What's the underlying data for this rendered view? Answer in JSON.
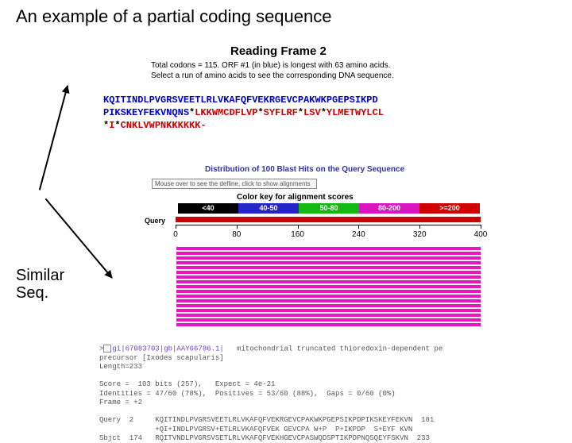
{
  "title": "An example of a partial coding sequence",
  "similar_label": "Similar\nSeq.",
  "reading_frame": {
    "heading": "Reading Frame 2",
    "sub1": "Total codons = 115.   ORF #1 (in blue) is longest with 63 amino acids.",
    "sub2": "Select a run of amino acids to see the corresponding DNA sequence.",
    "line1_orf": "KQITINDLPVGRSVEETLRLVKAFQFVEKRGEVCPAKWKPGEPSIKPD",
    "line2_orf": "PIKSKEYFEKVNQNS",
    "line2_star": "*",
    "line2_rest_a": "LKKWMCDFLVP",
    "line2_rest_b": "SYFLRF",
    "line2_rest_c": "LSV",
    "line2_rest_d": "YLMETWYLCL",
    "line3_a": "I",
    "line3_b": "CNKLVWPNKKKKKK-"
  },
  "blast": {
    "dist_title": "Distribution of 100 Blast Hits on the Query Sequence",
    "hint": "Mouse over to see the defline, click to show alignments",
    "color_key_title": "Color key for alignment scores",
    "key": [
      {
        "label": "<40",
        "bg": "#000000"
      },
      {
        "label": "40-50",
        "bg": "#2424c8"
      },
      {
        "label": "50-80",
        "bg": "#13b813"
      },
      {
        "label": "80-200",
        "bg": "#d815c0"
      },
      {
        "label": ">=200",
        "bg": "#d00000"
      }
    ],
    "query_label": "Query",
    "ticks": [
      "0",
      "80",
      "160",
      "240",
      "320",
      "400"
    ],
    "hit_count": 17
  },
  "alignment": {
    "header_link": "gi|67083703|gb|AAY66786.1|",
    "header_rest": "   mitochondrial truncated thioredoxin-dependent pe",
    "precursor": "precursor [Ixodes scapularis]",
    "length": "Length=233",
    "score_line": "Score =  103 bits (257),   Expect = 4e-21",
    "ident_line": "Identities = 47/60 (78%),  Positives = 53/60 (88%),  Gaps = 0/60 (0%)",
    "frame_line": "Frame = +2",
    "q_label": "Query  2",
    "q_seq": "KQITINDLPVGRSVEETLRLVKAFQFVEKRGEVCPAKWKPGEPSIKPDPIKSKEYFEKVN  181",
    "mid": "+QI+INDLPVGRSV+ETLRLVKAFQFVEK GEVCPA W+P  P+IKPDP  S+EYF KVN",
    "s_label": "Sbjct  174",
    "s_seq": "RQITVNDLPVGRSVSETLRLVKAFQFVEKHGEVCPASWQDSPTIKPDPNQSQEYFSKVN  233"
  }
}
